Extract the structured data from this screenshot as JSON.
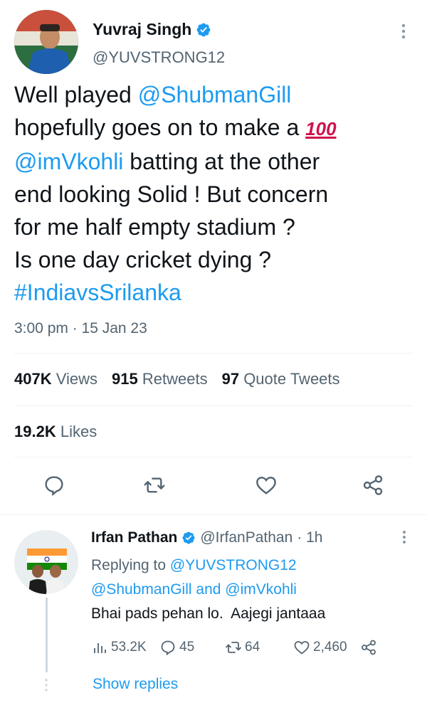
{
  "main_tweet": {
    "author_name": "Yuvraj Singh",
    "author_handle": "@YUVSTRONG12",
    "text_lines": [
      [
        {
          "t": "Well played ",
          "c": "text"
        },
        {
          "t": "@ShubmanGill",
          "c": "mention"
        }
      ],
      [
        {
          "t": "hopefully goes on to make a ",
          "c": "text"
        },
        {
          "t": "100",
          "c": "emoji"
        }
      ],
      [
        {
          "t": "@imVkohli",
          "c": "mention"
        },
        {
          "t": " batting at the other",
          "c": "text"
        }
      ],
      [
        {
          "t": "end looking Solid ! But concern",
          "c": "text"
        }
      ],
      [
        {
          "t": "for me half empty stadium ?",
          "c": "text"
        }
      ],
      [
        {
          "t": "Is one day cricket dying ?",
          "c": "text"
        }
      ],
      [
        {
          "t": "#IndiavsSrilanka",
          "c": "hashtag"
        }
      ]
    ],
    "timestamp": "3:00 pm · 15 Jan 23",
    "views_count": "407K",
    "views_label": "Views",
    "retweets_count": "915",
    "retweets_label": "Retweets",
    "quotes_count": "97",
    "quotes_label": "Quote Tweets",
    "likes_count": "19.2K",
    "likes_label": "Likes",
    "action_icons": [
      "reply-icon",
      "retweet-icon",
      "like-icon",
      "share-icon"
    ]
  },
  "reply": {
    "author_name": "Irfan Pathan",
    "author_handle": "@IrfanPathan",
    "time": "· 1h",
    "replying_to_label": "Replying to",
    "replying_to_user1": "@YUVSTRONG12",
    "replying_to_user2": "@ShubmanGill",
    "replying_and": "and",
    "replying_to_user3": "@imVkohli",
    "text": "Bhai pads pehan lo.  Aajegi jantaaa",
    "views": "53.2K",
    "replies": "45",
    "retweets": "64",
    "likes": "2,460",
    "show_replies_label": "Show replies"
  },
  "colors": {
    "accent": "#1d9bf0",
    "text": "#0f1419",
    "secondary": "#536471",
    "emoji_red": "#d0104c"
  }
}
